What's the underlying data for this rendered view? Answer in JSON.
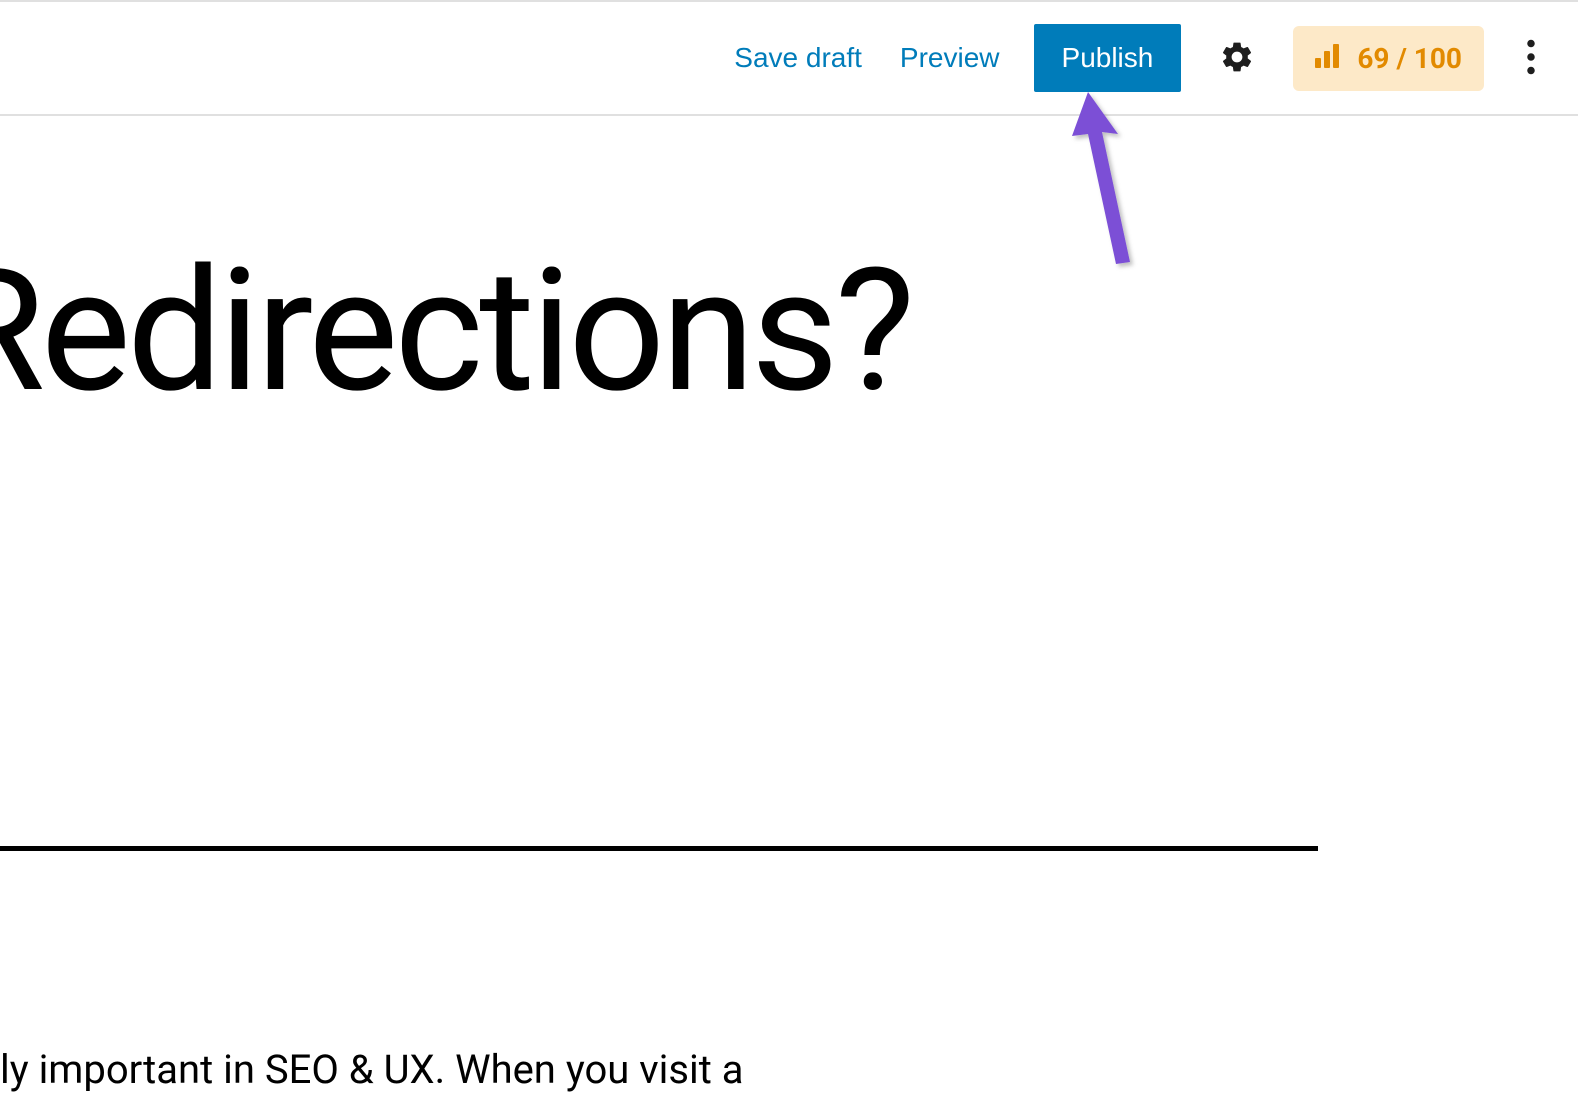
{
  "toolbar": {
    "save_draft": "Save draft",
    "preview": "Preview",
    "publish": "Publish",
    "score": "69 / 100"
  },
  "post": {
    "title_fragment": " Redirections?",
    "body_fragment": "ly important in SEO & UX. When you visit a"
  }
}
